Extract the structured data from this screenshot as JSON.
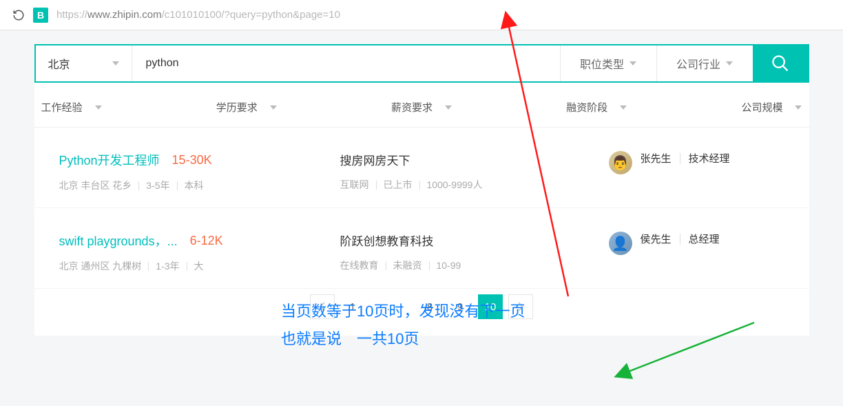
{
  "browser": {
    "url_proto": "https://",
    "url_host": "www.zhipin.com",
    "url_path": "/c101010100/?query=python&page=10",
    "badge": "B"
  },
  "search": {
    "city": "北京",
    "query": "python",
    "job_type": "职位类型",
    "industry": "公司行业"
  },
  "filters": {
    "exp": "工作经验",
    "edu": "学历要求",
    "salary": "薪资要求",
    "finance": "融资阶段",
    "scale": "公司规模"
  },
  "jobs": [
    {
      "title": "Python开发工程师",
      "salary": "15-30K",
      "loc": "北京 丰台区 花乡",
      "exp": "3-5年",
      "edu": "本科",
      "company": "搜房网房天下",
      "tag1": "互联网",
      "tag2": "已上市",
      "tag3": "1000-9999人",
      "hr": "张先生",
      "hr_title": "技术经理"
    },
    {
      "title": "swift playgrounds，...",
      "salary": "6-12K",
      "loc": "北京 通州区 九棵树",
      "exp": "1-3年",
      "edu": "大",
      "company": "阶跃创想教育科技",
      "tag1": "在线教育",
      "tag2": "未融资",
      "tag3": "10-99",
      "hr": "侯先生",
      "hr_title": "总经理"
    }
  ],
  "pagination": {
    "p1": "1",
    "dots": "...",
    "p8": "8",
    "p9": "9",
    "p10": "10"
  },
  "annotation": {
    "line1": "当页数等于10页时，发现没有下一页",
    "line2": "也就是说　一共10页"
  }
}
